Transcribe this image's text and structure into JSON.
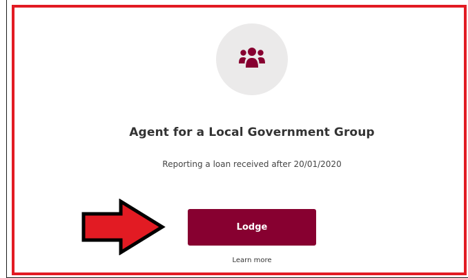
{
  "card": {
    "title": "Agent for a Local Government Group",
    "subtitle": "Reporting a loan received after 20/01/2020",
    "icon": "users-group-icon",
    "lodge_label": "Lodge",
    "learn_more_label": "Learn more"
  },
  "colors": {
    "accent": "#870030",
    "highlight": "#e21b23",
    "icon_bg": "#ebeaea"
  }
}
